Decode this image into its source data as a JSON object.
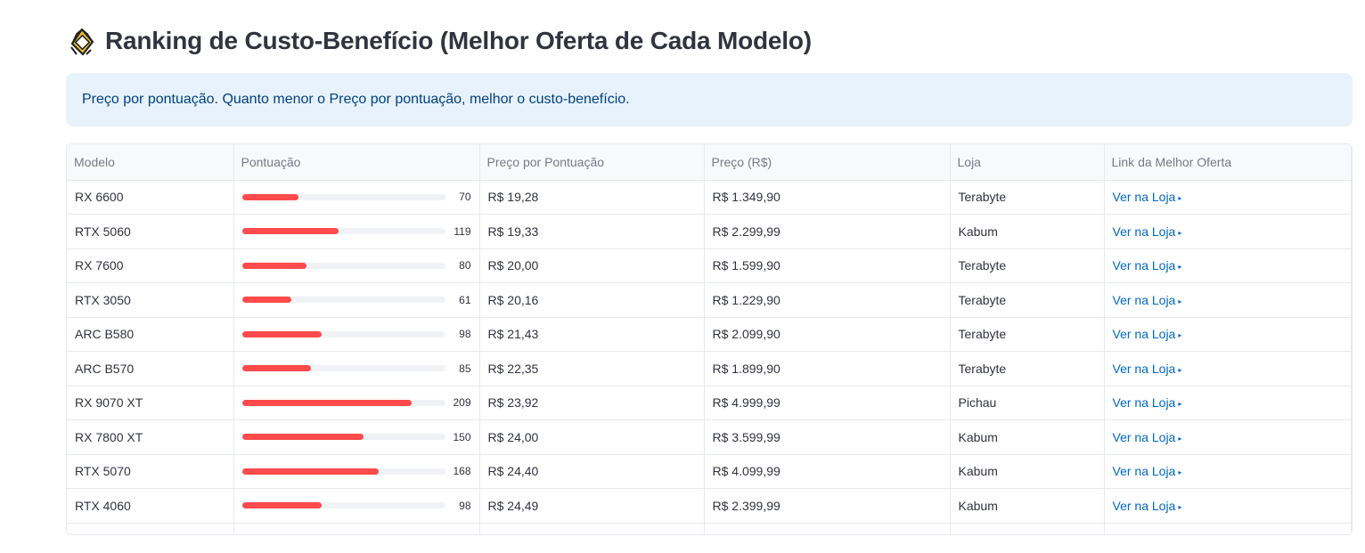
{
  "header": {
    "title": "Ranking de Custo-Benefício (Melhor Oferta de Cada Modelo)",
    "icon": "medal-diamond-icon"
  },
  "info": {
    "text": "Preço por pontuação. Quanto menor o Preço por pontuação, melhor o custo-benefício."
  },
  "table": {
    "columns": [
      "Modelo",
      "Pontuação",
      "Preço por Pontuação",
      "Preço (R$)",
      "Loja",
      "Link da Melhor Oferta"
    ],
    "score_max": 250,
    "rows": [
      {
        "model": "RX 6600",
        "score": 70,
        "score_text": "70",
        "ppp": "R$ 19,28",
        "price": "R$ 1.349,90",
        "store": "Terabyte",
        "link": "Ver na Loja"
      },
      {
        "model": "RTX 5060",
        "score": 119,
        "score_text": "119",
        "ppp": "R$ 19,33",
        "price": "R$ 2.299,99",
        "store": "Kabum",
        "link": "Ver na Loja"
      },
      {
        "model": "RX 7600",
        "score": 80,
        "score_text": "80",
        "ppp": "R$ 20,00",
        "price": "R$ 1.599,90",
        "store": "Terabyte",
        "link": "Ver na Loja"
      },
      {
        "model": "RTX 3050",
        "score": 61,
        "score_text": "61",
        "ppp": "R$ 20,16",
        "price": "R$ 1.229,90",
        "store": "Terabyte",
        "link": "Ver na Loja"
      },
      {
        "model": "ARC B580",
        "score": 98,
        "score_text": "98",
        "ppp": "R$ 21,43",
        "price": "R$ 2.099,90",
        "store": "Terabyte",
        "link": "Ver na Loja"
      },
      {
        "model": "ARC B570",
        "score": 85,
        "score_text": "85",
        "ppp": "R$ 22,35",
        "price": "R$ 1.899,90",
        "store": "Terabyte",
        "link": "Ver na Loja"
      },
      {
        "model": "RX 9070 XT",
        "score": 209,
        "score_text": "209",
        "ppp": "R$ 23,92",
        "price": "R$ 4.999,99",
        "store": "Pichau",
        "link": "Ver na Loja"
      },
      {
        "model": "RX 7800 XT",
        "score": 150,
        "score_text": "150",
        "ppp": "R$ 24,00",
        "price": "R$ 3.599,99",
        "store": "Kabum",
        "link": "Ver na Loja"
      },
      {
        "model": "RTX 5070",
        "score": 168,
        "score_text": "168",
        "ppp": "R$ 24,40",
        "price": "R$ 4.099,99",
        "store": "Kabum",
        "link": "Ver na Loja"
      },
      {
        "model": "RTX 4060",
        "score": 98,
        "score_text": "98",
        "ppp": "R$ 24,49",
        "price": "R$ 2.399,99",
        "store": "Kabum",
        "link": "Ver na Loja"
      }
    ]
  },
  "colors": {
    "bar_fill": "#ff4b4b",
    "bar_track": "#f0f2f6",
    "link": "#0068c9",
    "info_bg": "#e8f2fc",
    "info_text": "#004280"
  }
}
